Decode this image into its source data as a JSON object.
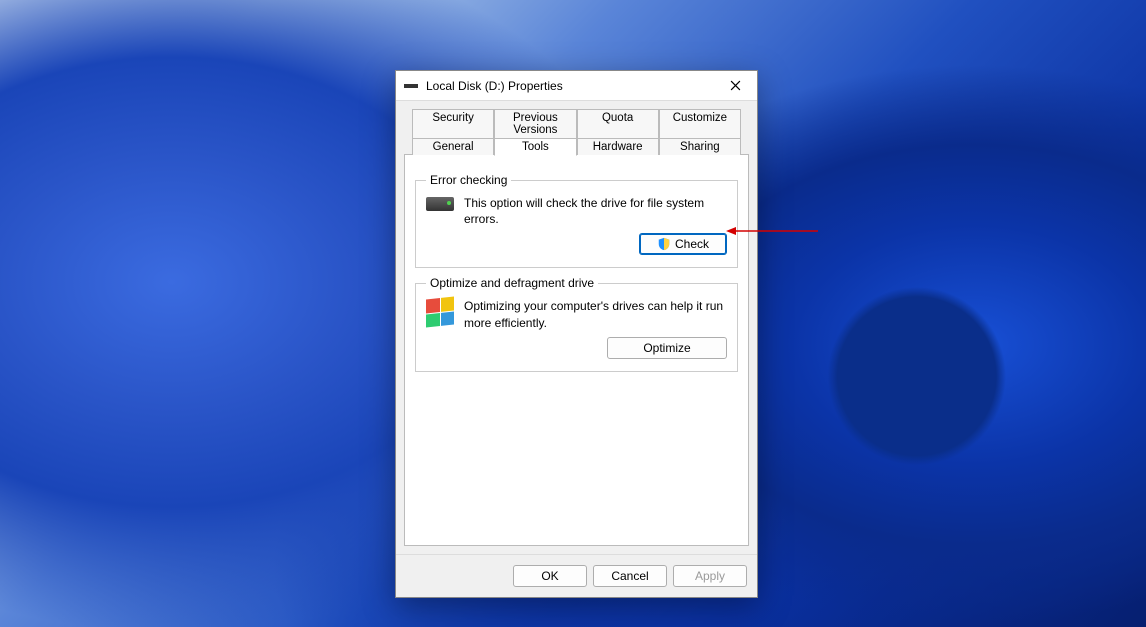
{
  "window": {
    "title": "Local Disk (D:) Properties"
  },
  "tabs": {
    "row1": [
      {
        "id": "security",
        "label": "Security"
      },
      {
        "id": "previous-versions",
        "label": "Previous Versions"
      },
      {
        "id": "quota",
        "label": "Quota"
      },
      {
        "id": "customize",
        "label": "Customize"
      }
    ],
    "row2": [
      {
        "id": "general",
        "label": "General"
      },
      {
        "id": "tools",
        "label": "Tools",
        "active": true
      },
      {
        "id": "hardware",
        "label": "Hardware"
      },
      {
        "id": "sharing",
        "label": "Sharing"
      }
    ]
  },
  "groups": {
    "errorChecking": {
      "legend": "Error checking",
      "text": "This option will check the drive for file system errors.",
      "button": "Check"
    },
    "optimize": {
      "legend": "Optimize and defragment drive",
      "text": "Optimizing your computer's drives can help it run more efficiently.",
      "button": "Optimize"
    }
  },
  "footer": {
    "ok": "OK",
    "cancel": "Cancel",
    "apply": "Apply"
  }
}
